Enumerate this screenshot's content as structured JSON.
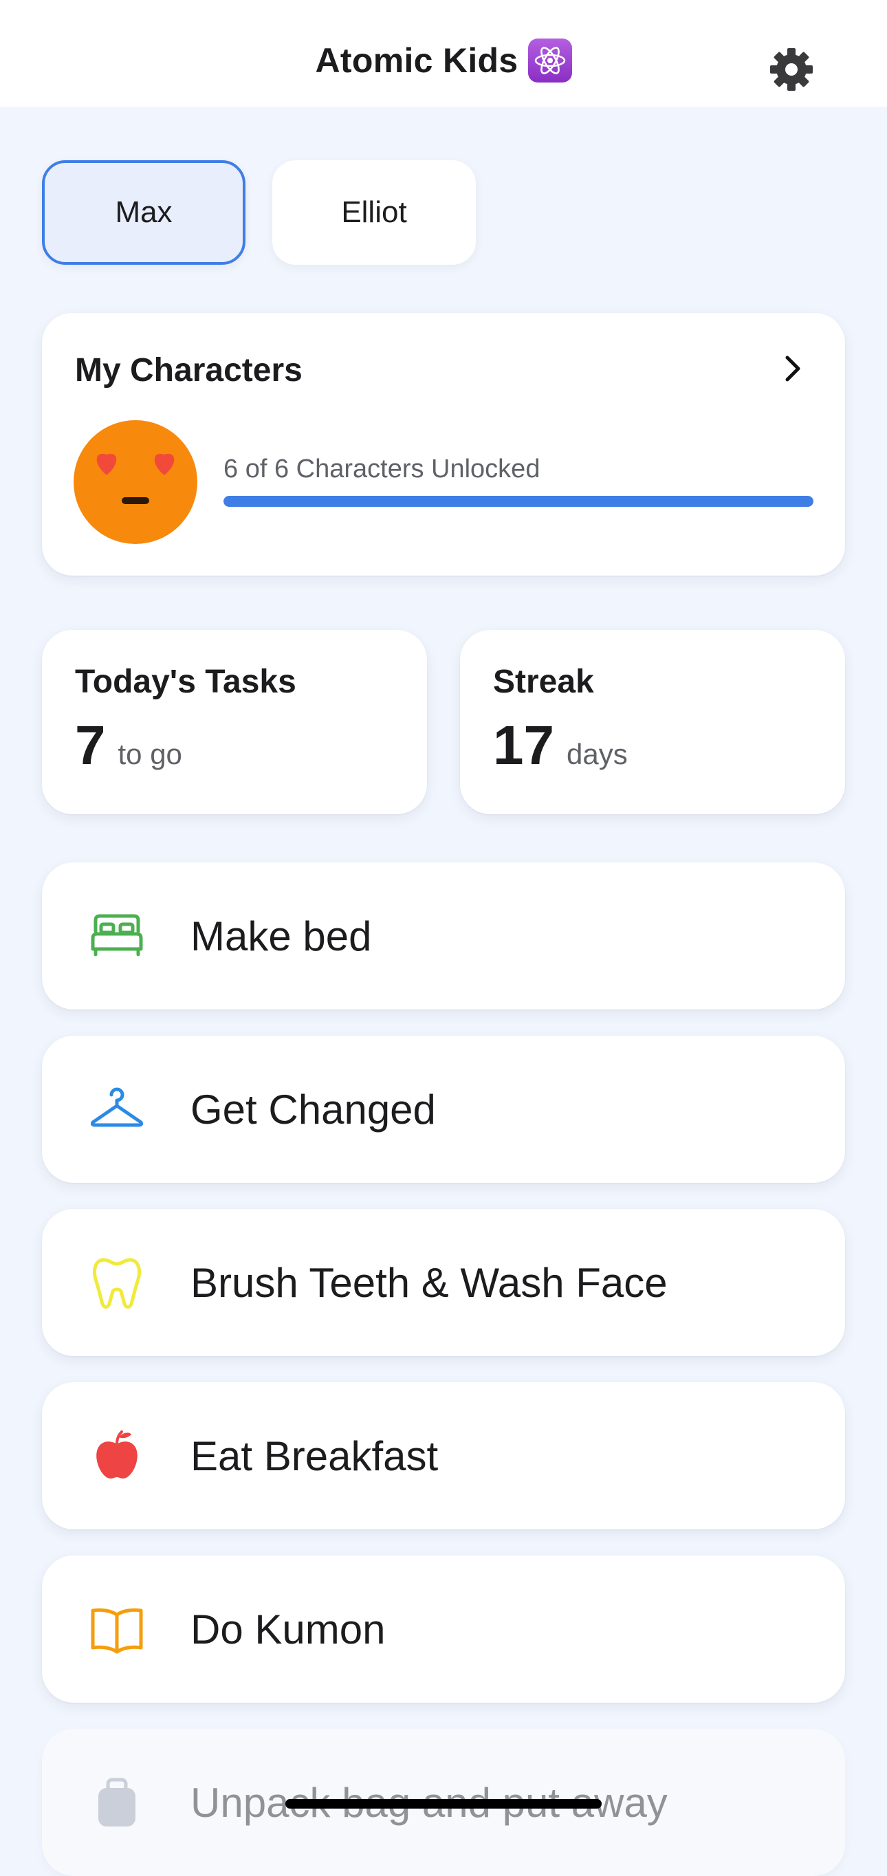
{
  "app": {
    "title": "Atomic Kids",
    "settings_icon": "gear-icon",
    "badge_icon": "atom-icon"
  },
  "profiles": [
    {
      "label": "Max",
      "selected": true
    },
    {
      "label": "Elliot",
      "selected": false
    }
  ],
  "characters": {
    "title": "My Characters",
    "progress_label": "6 of 6 Characters Unlocked",
    "progress_fraction": 1.0,
    "avatar_icon": "heart-eyes-face-icon",
    "accent_color": "#3f7ee5"
  },
  "stats": {
    "tasks": {
      "title": "Today's Tasks",
      "value": "7",
      "unit": "to go"
    },
    "streak": {
      "title": "Streak",
      "value": "17",
      "unit": "days"
    }
  },
  "tasks": [
    {
      "label": "Make bed",
      "icon": "bed-icon",
      "color": "#4caf50"
    },
    {
      "label": "Get Changed",
      "icon": "hanger-icon",
      "color": "#2a8ae6"
    },
    {
      "label": "Brush Teeth & Wash Face",
      "icon": "tooth-icon",
      "color": "#f1ea3a"
    },
    {
      "label": "Eat Breakfast",
      "icon": "apple-icon",
      "color": "#ef4444"
    },
    {
      "label": "Do Kumon",
      "icon": "book-icon",
      "color": "#f59e0b"
    },
    {
      "label": "Unpack bag and put away",
      "icon": "backpack-icon",
      "color": "#9ca3af"
    }
  ]
}
